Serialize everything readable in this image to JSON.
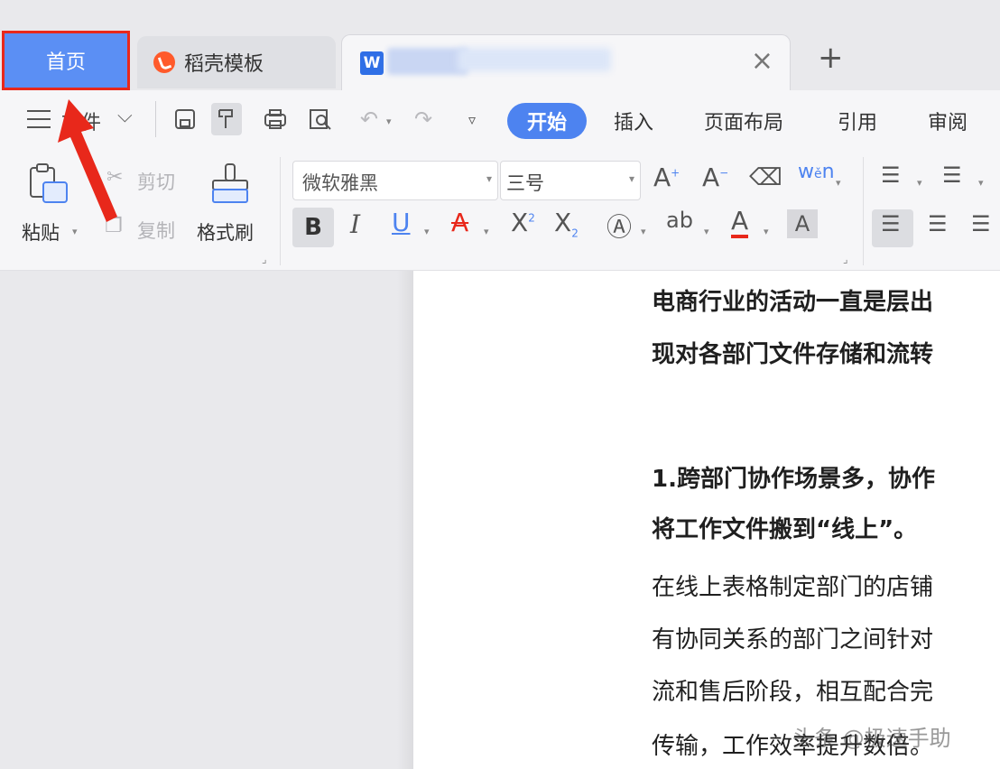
{
  "tabs": {
    "home": "首页",
    "template": "稻壳模板",
    "doc_icon": "W",
    "close": "×",
    "add": "+"
  },
  "toolbar": {
    "file_menu": "文件",
    "start": "开始",
    "menu_tabs": [
      "插入",
      "页面布局",
      "引用",
      "审阅"
    ]
  },
  "ribbon": {
    "paste": "粘贴",
    "cut": "剪切",
    "copy": "复制",
    "format_painter": "格式刷",
    "font_name": "微软雅黑",
    "font_size": "三号"
  },
  "document": {
    "lines": [
      "电商行业的活动一直是层出",
      "现对各部门文件存储和流转",
      "1.跨部门协作场景多，协作",
      "将工作文件搬到“线上”。",
      "在线上表格制定部门的店铺",
      "有协同关系的部门之间针对",
      "流和售后阶段，相互配合完",
      "传输，工作效率提升数倍。"
    ],
    "watermark": "头条 @极速手助"
  },
  "colors": {
    "home_tab": "#5b8ff4",
    "highlight_border": "#e8281b",
    "start_pill": "#4d83f0",
    "arrow": "#e8281b"
  }
}
